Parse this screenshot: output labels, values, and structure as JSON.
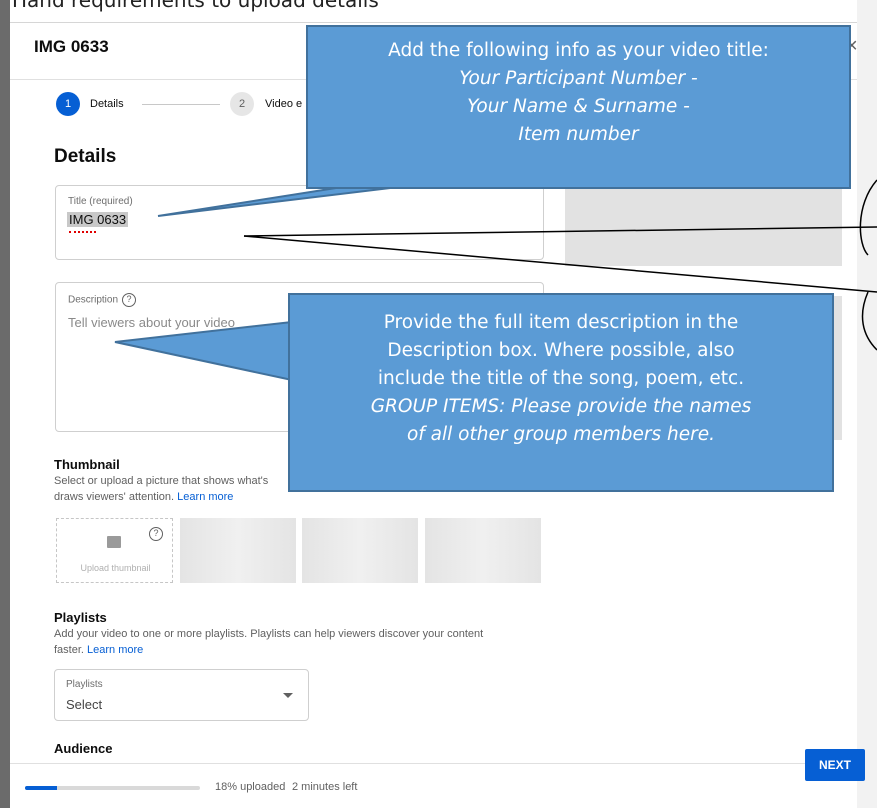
{
  "background": {
    "top_text": "Hand requirements to upload details"
  },
  "dialog": {
    "title": "IMG 0633",
    "close_glyph": "×"
  },
  "steps": [
    {
      "number": "1",
      "label": "Details"
    },
    {
      "number": "2",
      "label": "Video e"
    }
  ],
  "details": {
    "heading": "Details",
    "title_field": {
      "label": "Title (required)",
      "value": "IMG 0633"
    },
    "description_field": {
      "label": "Description",
      "placeholder": "Tell viewers about your video"
    }
  },
  "thumbnail": {
    "heading": "Thumbnail",
    "text": "Select or upload a picture that shows what's",
    "text2": "draws viewers' attention.",
    "learn_more": "Learn more",
    "upload_label": "Upload thumbnail"
  },
  "playlists": {
    "heading": "Playlists",
    "text": "Add your video to one or more playlists. Playlists can help viewers discover your content",
    "text2": "faster.",
    "learn_more": "Learn more",
    "select_label": "Playlists",
    "select_value": "Select"
  },
  "audience": {
    "heading": "Audience"
  },
  "footer": {
    "progress": 0.18,
    "upload_status": "18% uploaded",
    "time_left": "2 minutes left",
    "next_label": "NEXT"
  },
  "callouts": {
    "title_callout": {
      "line1": "Add the following info as your video title:",
      "line2": "Your Participant Number -",
      "line3": "Your Name & Surname -",
      "line4": "Item number"
    },
    "description_callout": {
      "line1": "Provide the full item description in the",
      "line2": "Description box.  Where possible, also",
      "line3": "include the title of the song, poem, etc.",
      "line4": "GROUP ITEMS: Please provide the names",
      "line5": "of all other group members here."
    }
  },
  "colors": {
    "accent": "#065fd4",
    "callout_fill": "#5b9bd5",
    "callout_border": "#41719c"
  }
}
